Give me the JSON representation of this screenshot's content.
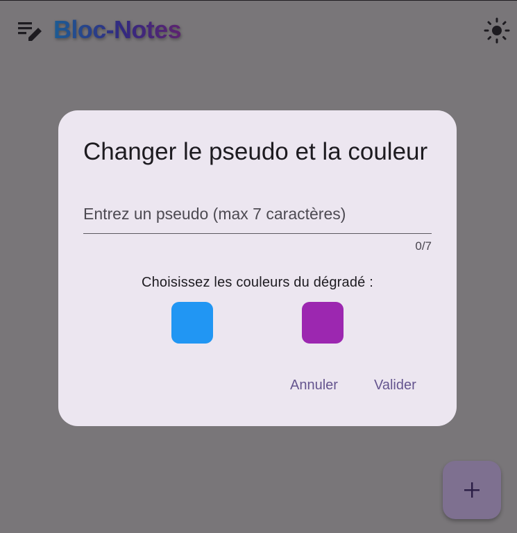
{
  "app": {
    "title": "Bloc-Notes",
    "title_gradient": [
      "#1c5c94",
      "#5d2470"
    ]
  },
  "icons": {
    "menu": "notes-edit-icon",
    "theme": "sun-icon",
    "fab": "plus-icon"
  },
  "dialog": {
    "title": "Changer le pseudo et la couleur",
    "pseudo_placeholder": "Entrez un pseudo (max 7 caractères)",
    "pseudo_value": "",
    "counter": "0/7",
    "colors_label": "Choisissez les couleurs du dégradé :",
    "swatches": [
      "#2196f3",
      "#9c27b0"
    ],
    "cancel_label": "Annuler",
    "confirm_label": "Valider"
  },
  "colors": {
    "scrim_background": "#797679",
    "dialog_surface": "#ece6f0",
    "primary_text": "#65558f"
  }
}
